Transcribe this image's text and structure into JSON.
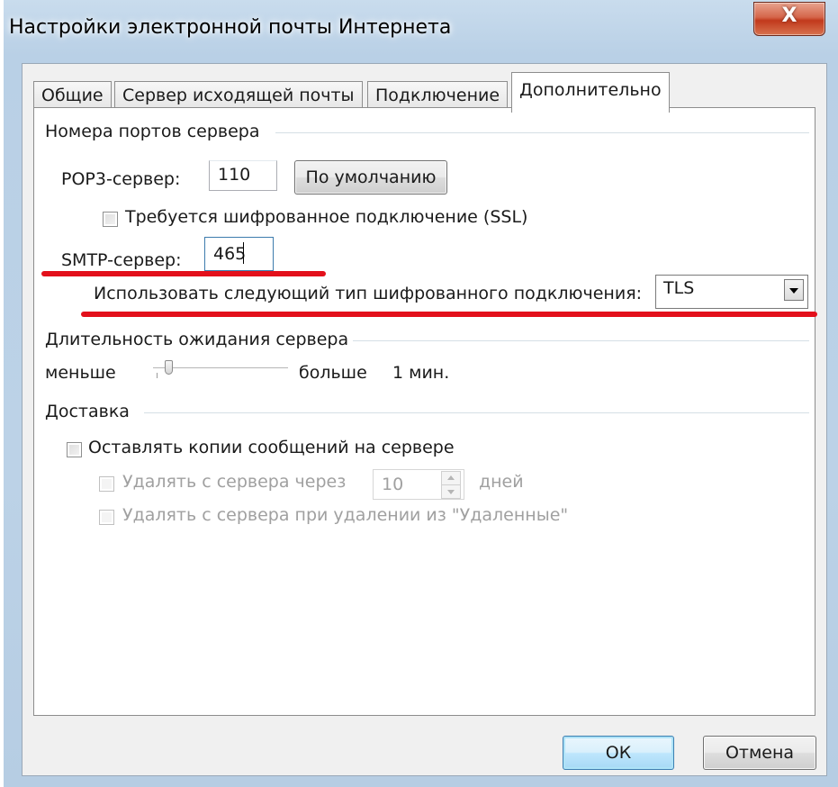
{
  "window": {
    "title": "Настройки электронной почты Интернета",
    "close_glyph": "X"
  },
  "tabs": [
    "Общие",
    "Сервер исходящей почты",
    "Подключение",
    "Дополнительно"
  ],
  "ports": {
    "group_label": "Номера портов сервера",
    "pop3_label": "POP3-сервер:",
    "pop3_value": "110",
    "default_button": "По умолчанию",
    "ssl_label": "Требуется шифрованное подключение (SSL)",
    "ssl_checked": false,
    "smtp_label": "SMTP-сервер:",
    "smtp_value": "465",
    "encryption_label": "Использовать следующий тип шифрованного подключения:",
    "encryption_value": "TLS"
  },
  "timeout": {
    "group_label": "Длительность ожидания сервера",
    "less_label": "меньше",
    "more_label": "больше",
    "value": "1 мин.",
    "slider_level": 0.05
  },
  "delivery": {
    "group_label": "Доставка",
    "keep_copies_label": "Оставлять копии сообщений на сервере",
    "keep_copies_checked": false,
    "remove_after_label": "Удалять с сервера через",
    "remove_after_value": "10",
    "days_label": "дней",
    "remove_deleted_label": "Удалять с сервера при удалении из \"Удаленные\""
  },
  "buttons": {
    "ok": "ОК",
    "cancel": "Отмена"
  },
  "colors": {
    "highlight_underline": "#e3101b",
    "window_frame": "#bcd2e7",
    "close_button": "#c1391c"
  }
}
